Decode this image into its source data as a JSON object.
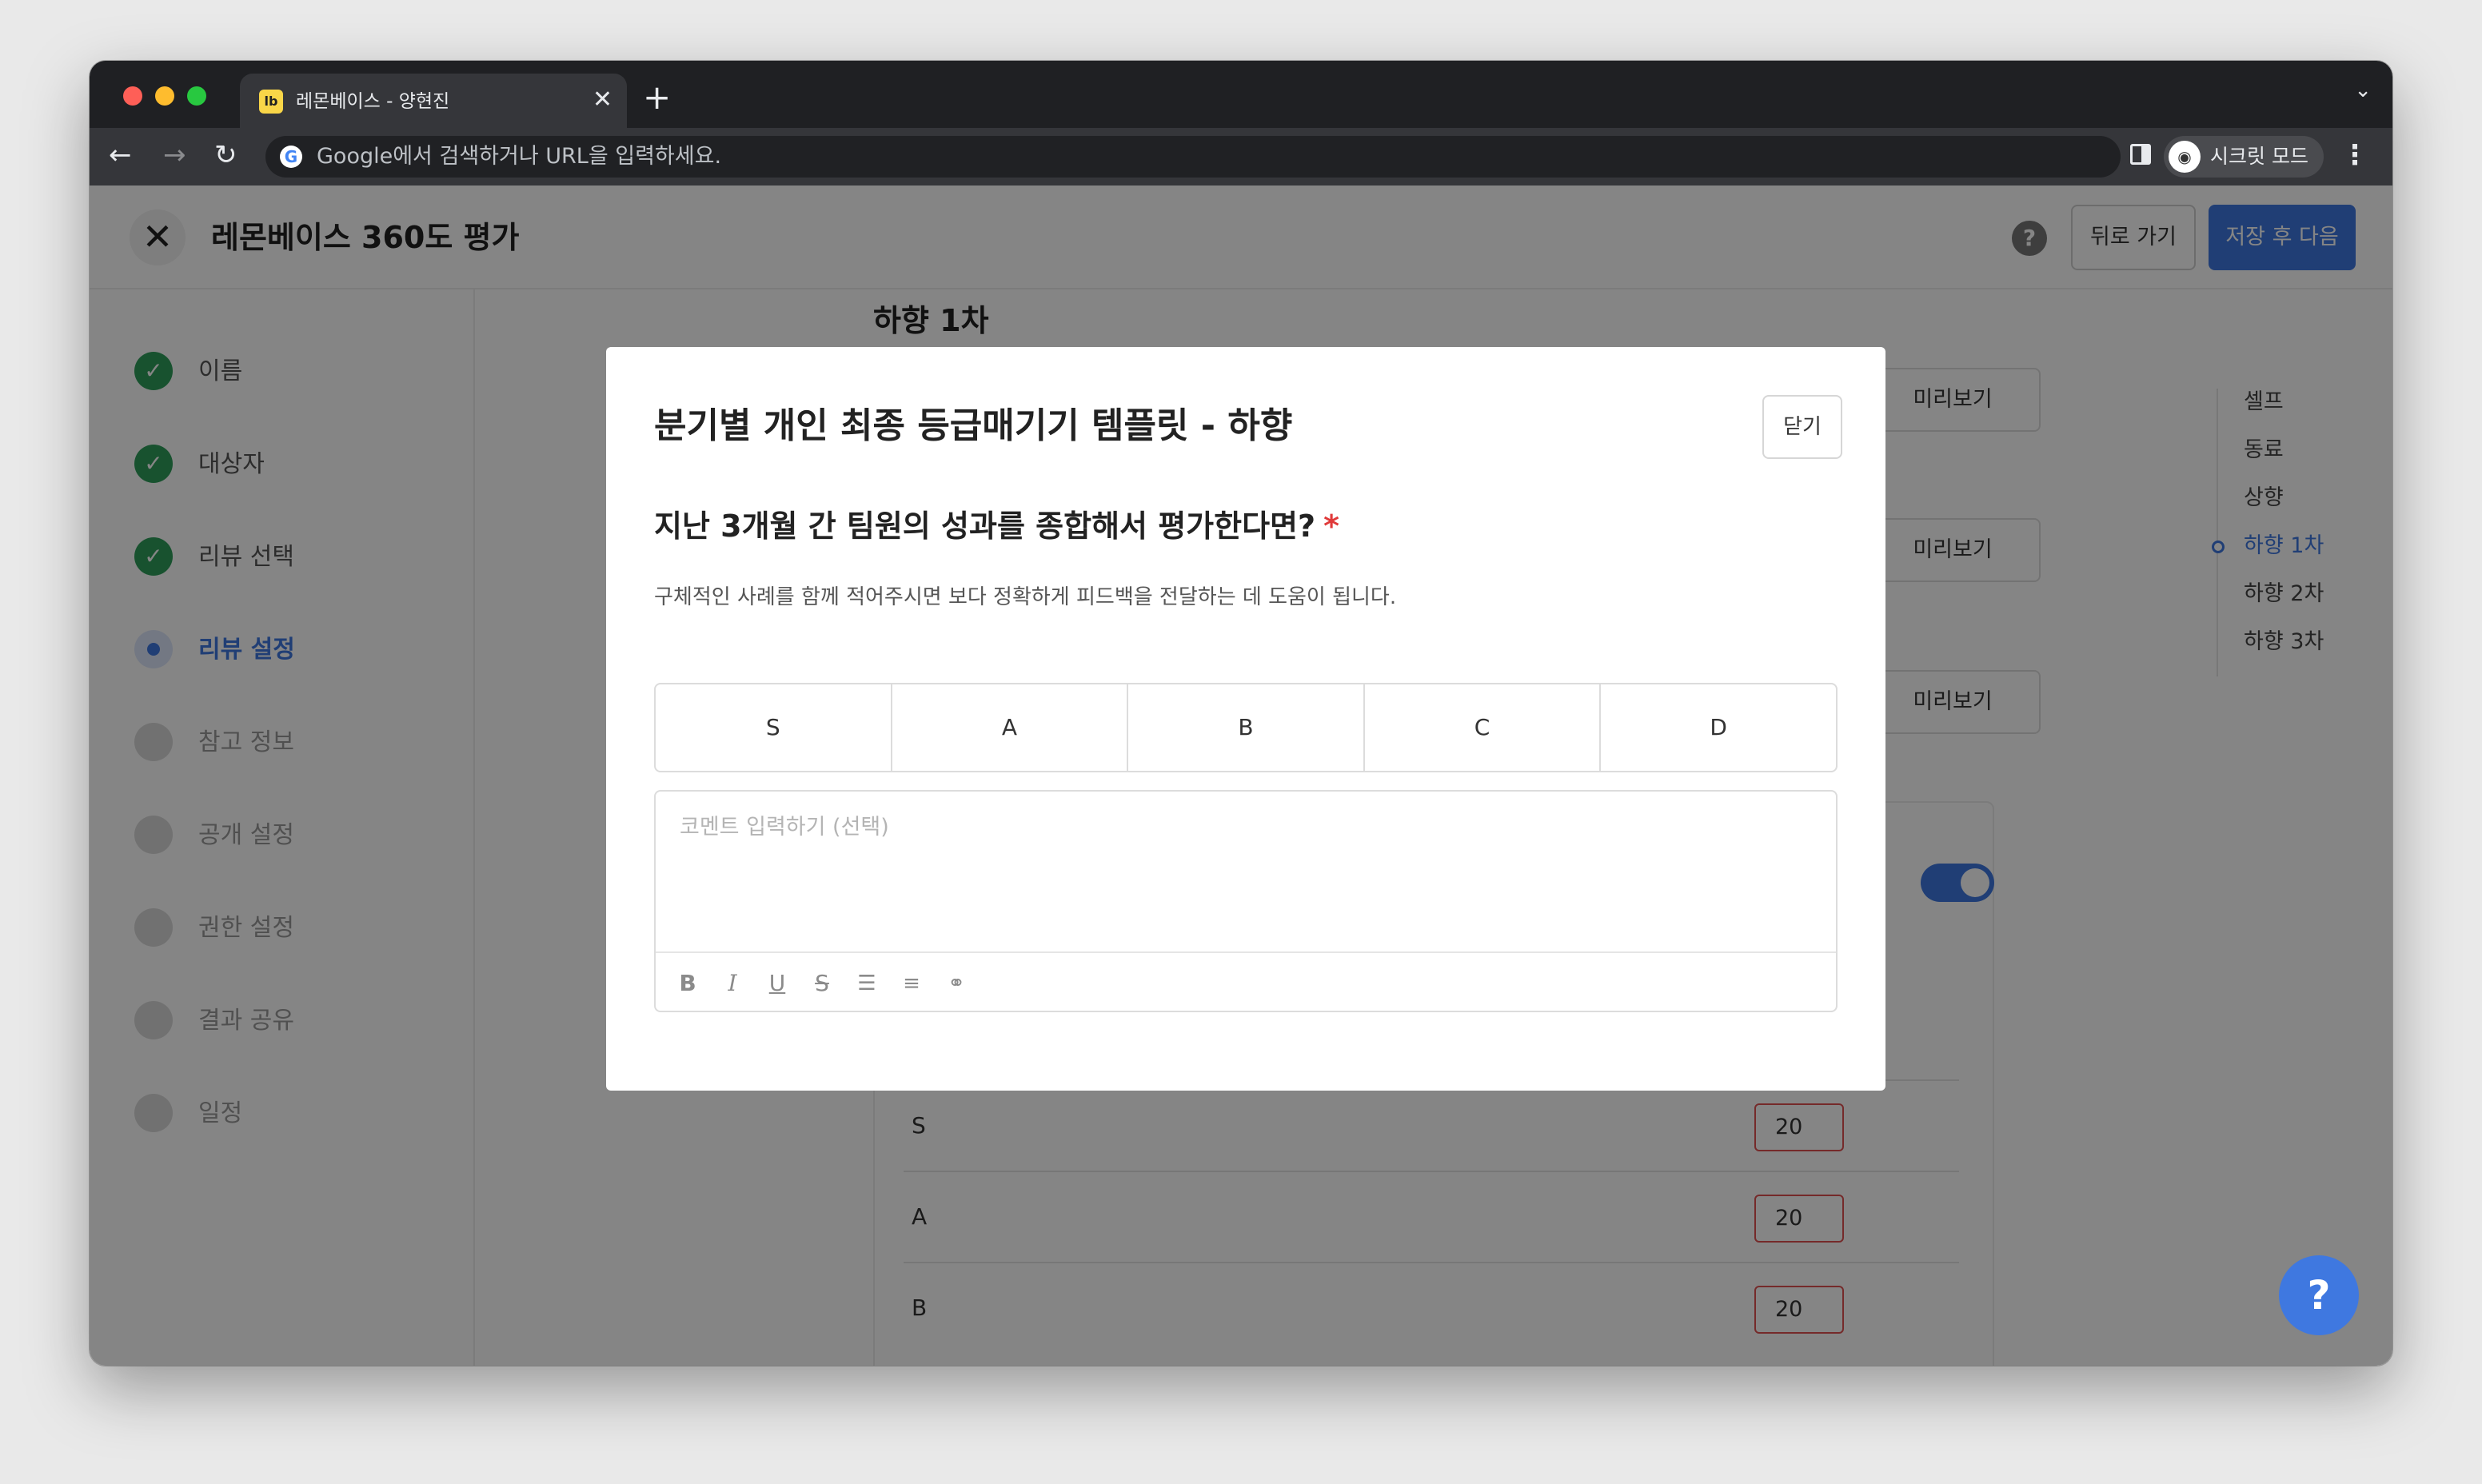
{
  "browser": {
    "tab_title": "레몬베이스 - 양현진",
    "tab_favicon": "lb",
    "omnibox_placeholder": "Google에서 검색하거나 URL을 입력하세요.",
    "incognito_label": "시크릿 모드"
  },
  "app": {
    "title": "레몬베이스 360도 평가",
    "back_button": "뒤로 가기",
    "next_button": "저장 후 다음",
    "section_title": "하향 1차",
    "accent_color": "#3f78e0"
  },
  "sidebar": {
    "steps": [
      {
        "label": "이름",
        "state": "done"
      },
      {
        "label": "대상자",
        "state": "done"
      },
      {
        "label": "리뷰 선택",
        "state": "done"
      },
      {
        "label": "리뷰 설정",
        "state": "active"
      },
      {
        "label": "참고 정보",
        "state": "pending"
      },
      {
        "label": "공개 설정",
        "state": "pending"
      },
      {
        "label": "권한 설정",
        "state": "pending"
      },
      {
        "label": "결과 공유",
        "state": "pending"
      },
      {
        "label": "일정",
        "state": "pending"
      }
    ]
  },
  "toc": {
    "items": [
      "셀프",
      "동료",
      "상향",
      "하향 1차",
      "하향 2차",
      "하향 3차"
    ],
    "active_index": 3
  },
  "preview_buttons": [
    "미리보기",
    "미리보기",
    "미리보기"
  ],
  "grade_rows": [
    {
      "grade": "S",
      "value": "20"
    },
    {
      "grade": "A",
      "value": "20"
    },
    {
      "grade": "B",
      "value": "20"
    }
  ],
  "modal": {
    "title": "분기별 개인 최종 등급매기기 템플릿 - 하향",
    "close_button": "닫기",
    "question": "지난 3개월 간 팀원의 성과를 종합해서 평가한다면?",
    "required_mark": "*",
    "description": "구체적인 사례를 함께 적어주시면 보다 정확하게 피드백을 전달하는 데 도움이 됩니다.",
    "grades": [
      "S",
      "A",
      "B",
      "C",
      "D"
    ],
    "comment_placeholder": "코멘트 입력하기 (선택)",
    "toolbar_tools": [
      "bold-icon",
      "italic-icon",
      "underline-icon",
      "strikethrough-icon",
      "ordered-list-icon",
      "bullet-list-icon",
      "link-icon"
    ]
  }
}
